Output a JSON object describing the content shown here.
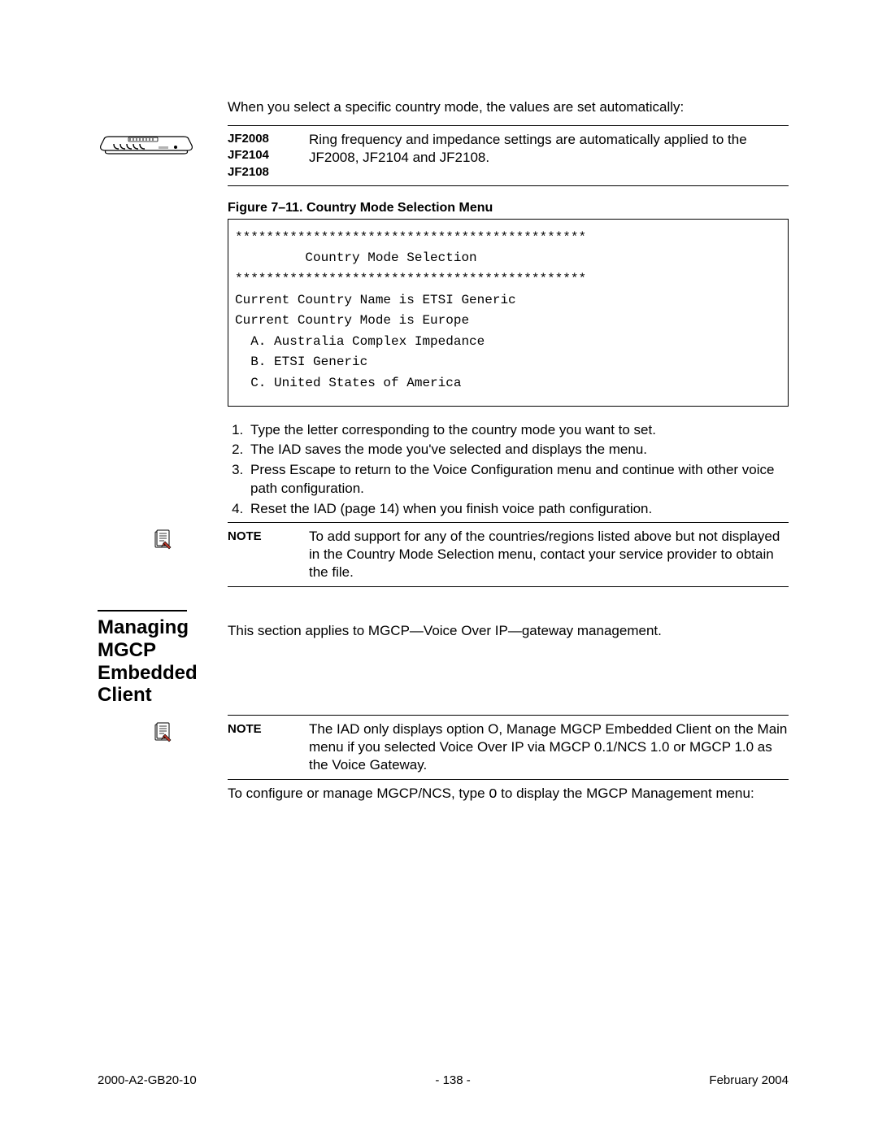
{
  "intro": "When you select a specific country mode, the values are set automatically:",
  "device": {
    "models": [
      "JF2008",
      "JF2104",
      "JF2108"
    ],
    "description": "Ring frequency and impedance settings are automatically applied to the JF2008, JF2104 and JF2108."
  },
  "figure": {
    "caption": "Figure 7–11.  Country Mode Selection Menu",
    "menu_text": "*********************************************\n         Country Mode Selection\n*********************************************\nCurrent Country Name is ETSI Generic\nCurrent Country Mode is Europe\n  A. Australia Complex Impedance\n  B. ETSI Generic\n  C. United States of America"
  },
  "steps": [
    "Type the letter corresponding to the country mode you want to set.",
    "The IAD saves the mode you've selected and displays the menu.",
    "Press Escape to return to the Voice Configuration menu and continue with other voice path configuration.",
    "Reset the IAD (page 14) when you finish voice path configuration."
  ],
  "note1": {
    "label": "NOTE",
    "text": "To add support for any of the countries/regions listed above but not displayed in the Country Mode Selection menu, contact your service provider to obtain the file."
  },
  "section": {
    "heading": "Managing MGCP Embedded Client",
    "intro": "This section applies to MGCP—Voice Over IP—gateway management."
  },
  "note2": {
    "label": "NOTE",
    "text": "The IAD only displays option O, Manage MGCP Embedded Client on the Main menu if you selected Voice Over IP via MGCP 0.1/NCS 1.0 or MGCP 1.0 as the Voice Gateway."
  },
  "body_after": {
    "pre": "To configure or manage MGCP/NCS, type ",
    "key": "O",
    "post": " to display the MGCP Management menu:"
  },
  "footer": {
    "left": "2000-A2-GB20-10",
    "center": "- 138 -",
    "right": "February 2004"
  }
}
